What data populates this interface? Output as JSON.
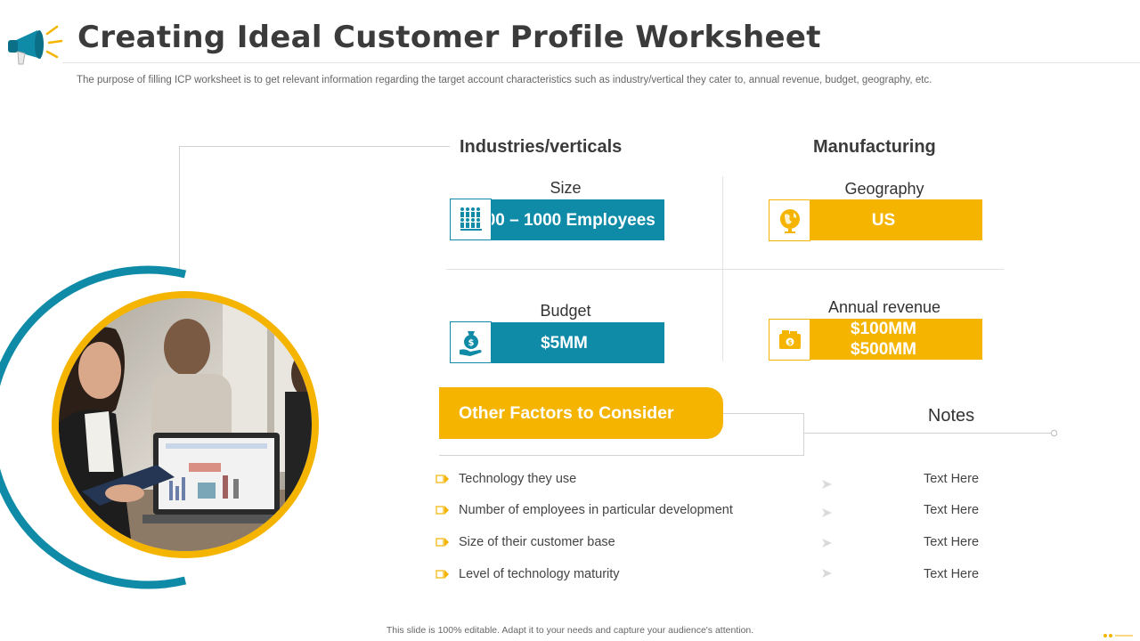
{
  "header": {
    "title": "Creating Ideal Customer Profile Worksheet",
    "subtitle": "The purpose of filling ICP worksheet is to get relevant information regarding the target account characteristics such as industry/vertical they cater to, annual revenue, budget, geography, etc."
  },
  "profile": {
    "industries_heading": "Industries/verticals",
    "manufacturing_heading": "Manufacturing",
    "size": {
      "label": "Size",
      "value": "500 – 1000 Employees",
      "icon": "people-icon"
    },
    "geography": {
      "label": "Geography",
      "value": "US",
      "icon": "globe-icon"
    },
    "budget": {
      "label": "Budget",
      "value": "$5MM",
      "icon": "money-bag-icon"
    },
    "revenue": {
      "label": "Annual revenue",
      "value": "$100MM $500MM",
      "icon": "wallet-icon"
    }
  },
  "factors": {
    "heading": "Other Factors to Consider",
    "notes_heading": "Notes",
    "items": [
      {
        "label": "Technology they use",
        "note": "Text Here"
      },
      {
        "label": "Number of employees in particular development",
        "note": "Text Here"
      },
      {
        "label": "Size of their customer base",
        "note": "Text Here"
      },
      {
        "label": "Level of technology maturity",
        "note": "Text Here"
      }
    ]
  },
  "footer": {
    "text": "This slide is 100% editable. Adapt it to your needs and capture your audience's attention."
  },
  "colors": {
    "teal": "#0f8ba8",
    "gold": "#f4b400",
    "title": "#3b3b3b"
  }
}
